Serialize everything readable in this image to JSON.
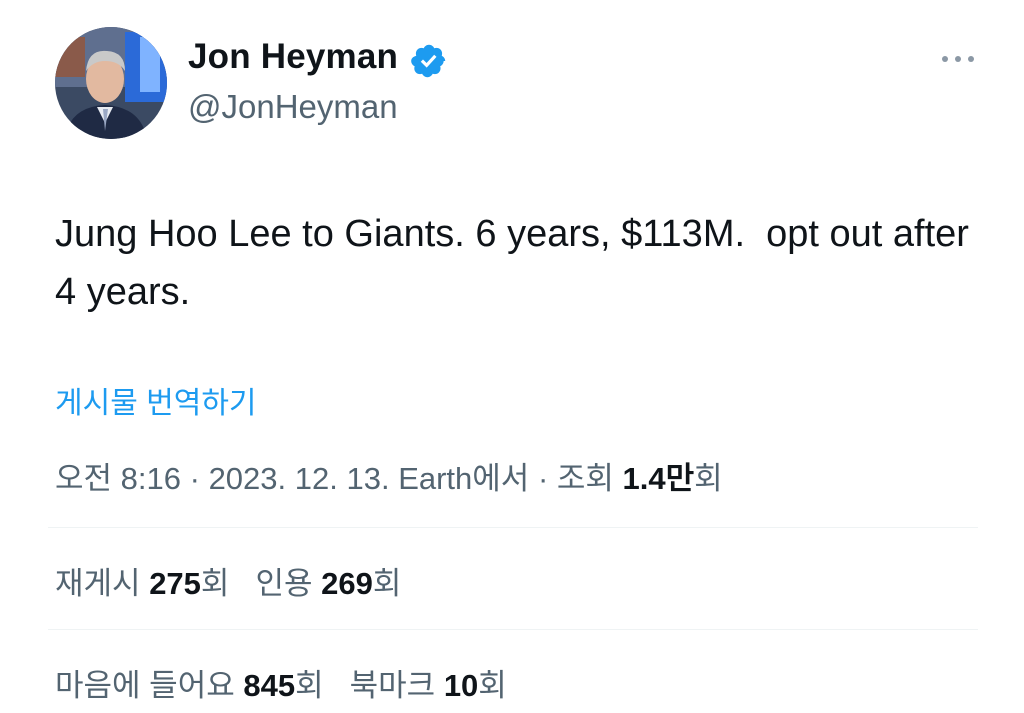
{
  "author": {
    "name": "Jon Heyman",
    "handle": "@JonHeyman",
    "verified": true
  },
  "tweet": {
    "text": "Jung Hoo Lee to Giants. 6 years, $113M.  opt out after 4 years.",
    "translate_label": "게시물 번역하기"
  },
  "meta": {
    "time": "오전 8:16",
    "separator": " · ",
    "date": "2023. 12. 13.",
    "source": "Earth에서",
    "views_prefix": "조회 ",
    "views_value": "1.4만",
    "views_suffix": "회"
  },
  "stats": {
    "reposts_label": "재게시 ",
    "reposts_value": "275",
    "reposts_suffix": "회",
    "quotes_label": "인용 ",
    "quotes_value": "269",
    "quotes_suffix": "회",
    "likes_label": "마음에 들어요 ",
    "likes_value": "845",
    "likes_suffix": "회",
    "bookmarks_label": "북마크 ",
    "bookmarks_value": "10",
    "bookmarks_suffix": "회"
  },
  "icons": {
    "verified": "verified-badge-icon",
    "more": "more-horizontal-icon"
  },
  "colors": {
    "text_primary": "#0f1419",
    "text_secondary": "#536471",
    "accent": "#1d9bf0",
    "divider": "#eff3f4"
  }
}
